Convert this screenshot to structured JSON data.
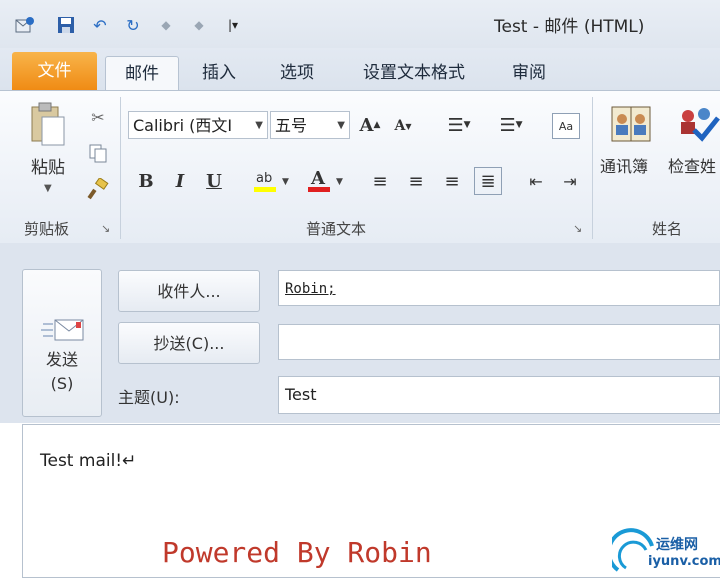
{
  "window": {
    "title": "Test  -  邮件 (HTML)"
  },
  "quick_access": {
    "icons": [
      "outlook-icon",
      "save-icon",
      "undo-icon",
      "redo-icon",
      "up-arrow-icon",
      "down-arrow-icon",
      "customize-icon"
    ]
  },
  "tabs": {
    "file": "文件",
    "mail": "邮件",
    "insert": "插入",
    "options": "选项",
    "format_text": "设置文本格式",
    "review": "审阅"
  },
  "ribbon": {
    "clipboard": {
      "paste_label": "粘贴",
      "group_label": "剪贴板"
    },
    "basic_text": {
      "font_name": "Calibri (西文I",
      "font_size": "五号",
      "bold": "B",
      "italic": "I",
      "underline": "U",
      "group_label": "普通文本"
    },
    "names": {
      "address_book": "通讯簿",
      "check_names": "检查姓",
      "group_label": "姓名"
    }
  },
  "compose": {
    "send_label": "发送",
    "send_shortcut": "(S)",
    "to_button": "收件人...",
    "cc_button": "抄送(C)...",
    "to_value": "Robin;",
    "cc_value": "",
    "subject_label": "主题(U):",
    "subject_value": "Test"
  },
  "body": {
    "text": "Test mail!↵",
    "signature": "Powered By Robin"
  },
  "watermark": {
    "cn": "运维网",
    "url": "iyunv.com"
  },
  "colors": {
    "file_tab": "#f08b14",
    "highlight": "#ffff00",
    "font_color": "#e02020",
    "signature": "#c0392b"
  }
}
